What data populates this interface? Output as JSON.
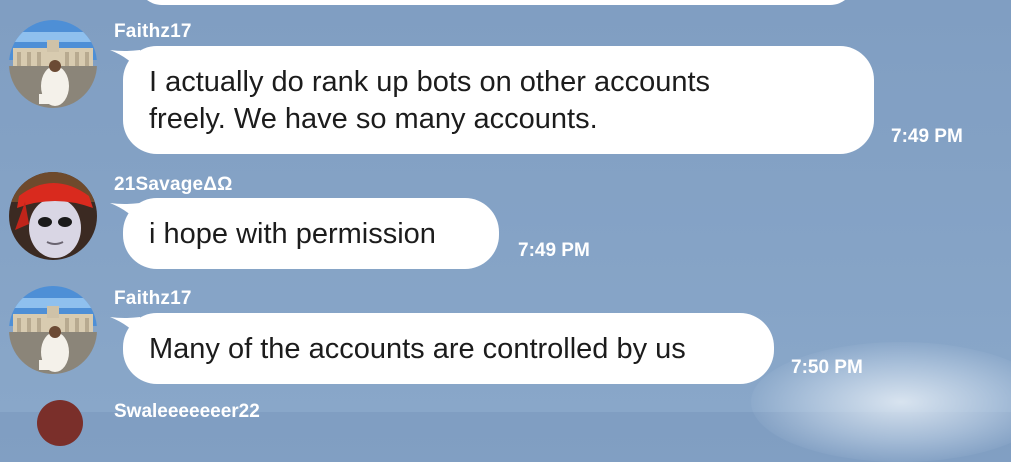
{
  "chat": {
    "messages": [
      {
        "sender": "Faithz17",
        "text_line1": "I actually do rank up bots on other accounts",
        "text_line2": "freely. We have so many accounts.",
        "time": "7:49 PM",
        "avatar": "vatican-square-photo"
      },
      {
        "sender": "21SavageΔΩ",
        "text": "i hope with permission",
        "time": "7:49 PM",
        "avatar": "red-bandana-character"
      },
      {
        "sender": "Faithz17",
        "text": "Many of the accounts are controlled by us",
        "time": "7:50 PM",
        "avatar": "vatican-square-photo"
      }
    ],
    "partial_next_sender": "Swaleeeeeeer22"
  }
}
